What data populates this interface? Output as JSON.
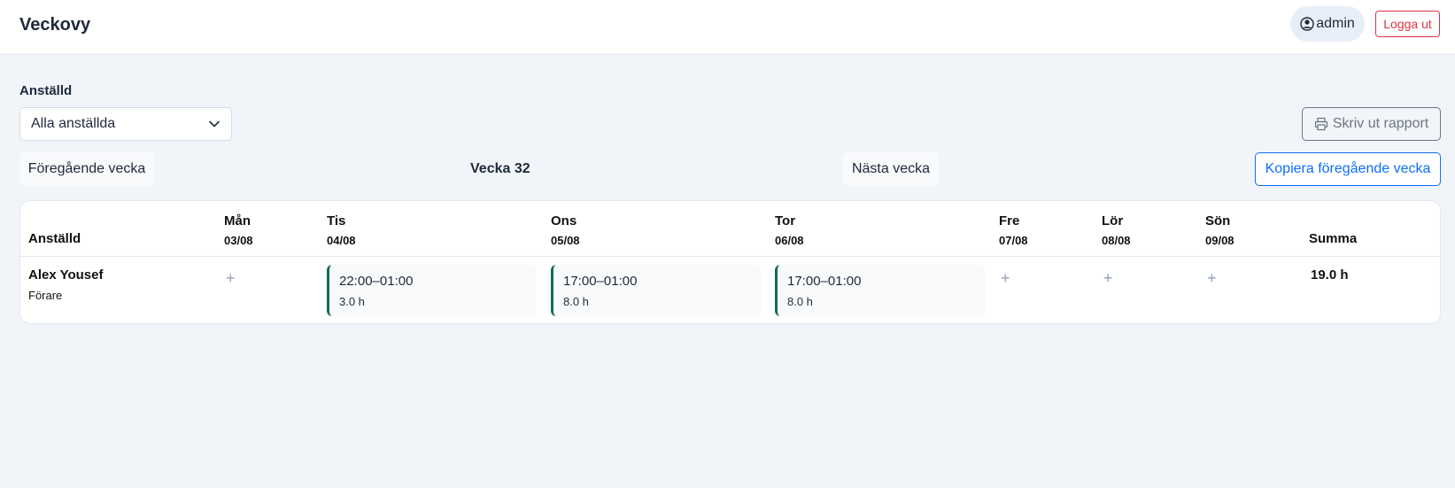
{
  "header": {
    "title": "Veckovy",
    "user_name": "admin",
    "logout_label": "Logga ut"
  },
  "filters": {
    "employee_label": "Anställd",
    "employee_selected": "Alla anställda",
    "print_label": "Skriv ut rapport"
  },
  "week_nav": {
    "prev_label": "Föregående vecka",
    "week_label": "Vecka 32",
    "next_label": "Nästa vecka",
    "copy_label": "Kopiera föregående vecka"
  },
  "table": {
    "employee_header": "Anställd",
    "total_header": "Summa",
    "days": [
      {
        "name": "Mån",
        "date": "03/08"
      },
      {
        "name": "Tis",
        "date": "04/08"
      },
      {
        "name": "Ons",
        "date": "05/08"
      },
      {
        "name": "Tor",
        "date": "06/08"
      },
      {
        "name": "Fre",
        "date": "07/08"
      },
      {
        "name": "Lör",
        "date": "08/08"
      },
      {
        "name": "Sön",
        "date": "09/08"
      }
    ],
    "rows": [
      {
        "name": "Alex Yousef",
        "role": "Förare",
        "shifts": {
          "tis": {
            "time": "22:00–01:00",
            "hours": "3.0 h"
          },
          "ons": {
            "time": "17:00–01:00",
            "hours": "8.0 h"
          },
          "tor": {
            "time": "17:00–01:00",
            "hours": "8.0 h"
          }
        },
        "total": "19.0 h"
      }
    ],
    "add_symbol": "+"
  },
  "colors": {
    "accent_blue": "#0d6efd",
    "danger_red": "#dc3545",
    "shift_border": "#0f6e56"
  }
}
